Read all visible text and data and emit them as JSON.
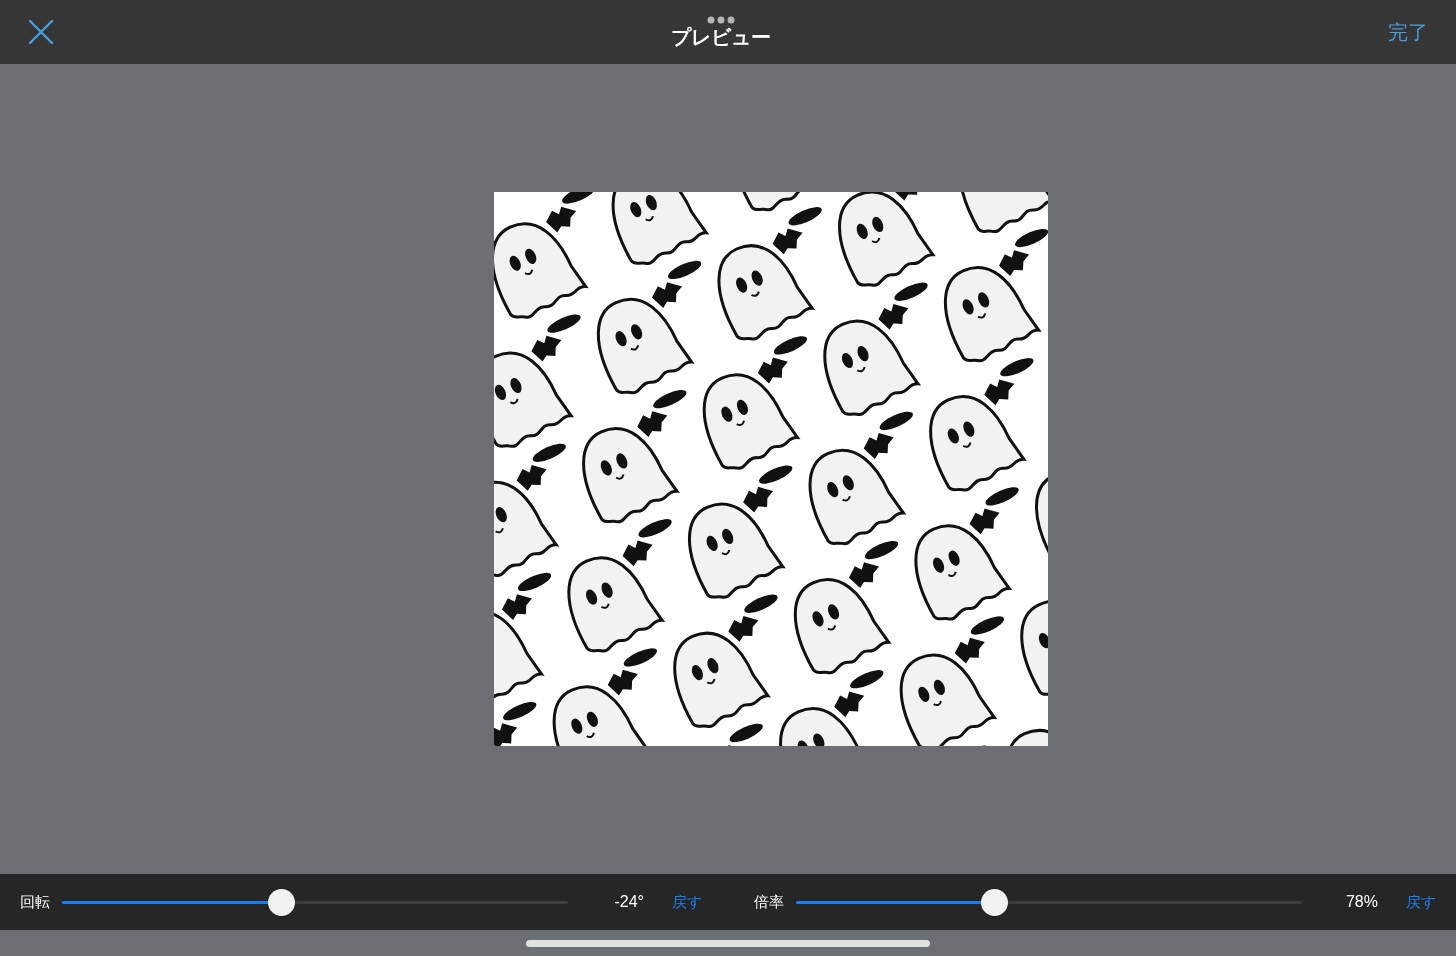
{
  "top_bar": {
    "title": "プレビュー",
    "done": "完了"
  },
  "controls": [
    {
      "label": "回転",
      "level": 0.433,
      "reading": "-24°",
      "reset": "戻す"
    },
    {
      "label": "倍率",
      "level": 0.392,
      "reading": "78%",
      "reset": "戻す"
    }
  ]
}
